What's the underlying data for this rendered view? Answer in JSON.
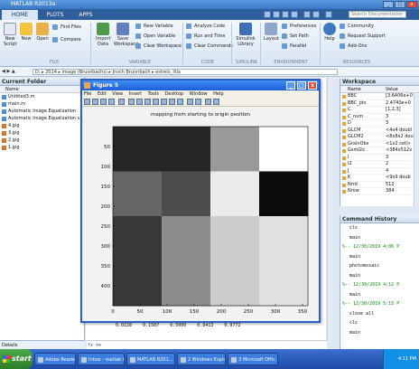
{
  "window": {
    "title": "MATLAB R2013a"
  },
  "ribbon_tabs": [
    "HOME",
    "PLOTS",
    "APPS"
  ],
  "search": {
    "placeholder": "Search Documentation"
  },
  "ribbon": {
    "file": [
      "New Script",
      "New",
      "Open",
      "Find Files",
      "Compare"
    ],
    "variable": [
      "Import Data",
      "Save Workspace",
      "New Variable",
      "Open Variable",
      "Clear Workspace"
    ],
    "code": [
      "Analyze Code",
      "Run and Time",
      "Clear Commands"
    ],
    "simulink": [
      "Simulink Library"
    ],
    "environment": [
      "Layout",
      "Preferences",
      "Set Path",
      "Parallel"
    ],
    "resources": [
      "Help",
      "Community",
      "Request Support",
      "Add-Ons"
    ],
    "sections": [
      "FILE",
      "VARIABLE",
      "CODE",
      "SIMULINK",
      "ENVIRONMENT",
      "RESOURCES"
    ]
  },
  "address": {
    "path": "D: ▸ 2014 ▸ image (Brusnbachs) ▸ Jnsch Brunnbach ▸ estrels_lilla"
  },
  "current_folder": {
    "title": "Current Folder",
    "column": "Name",
    "files": [
      "Untitled3.m",
      "main.m",
      "Automatic Image Equalization",
      "Automatic Image Equalization v",
      "4.jpg",
      "3.jpg",
      "2.jpg",
      "1.jpg"
    ],
    "details": "Details"
  },
  "figure": {
    "title": "Figure 5",
    "menu": [
      "File",
      "Edit",
      "View",
      "Insert",
      "Tools",
      "Desktop",
      "Window",
      "Help"
    ],
    "plot_title": "mapping from starting to origin position"
  },
  "chart_data": {
    "type": "heatmap",
    "title": "mapping from starting to origin position",
    "x_ticks": [
      0,
      50,
      100,
      150,
      200,
      250,
      300,
      350
    ],
    "y_ticks": [
      50,
      100,
      150,
      200,
      250,
      300,
      350,
      400
    ],
    "xlim": [
      0,
      360
    ],
    "ylim": [
      0,
      450
    ],
    "y_reversed": true,
    "grid_rows": 3,
    "grid_cols": 4,
    "cell_gray": [
      [
        0.15,
        0.15,
        0.6,
        1.0
      ],
      [
        0.4,
        0.3,
        0.92,
        0.05
      ],
      [
        0.22,
        0.55,
        0.8,
        0.88
      ]
    ],
    "last_row_gray": [
      0.22,
      0.55,
      0.8,
      0.88
    ]
  },
  "command_window": {
    "values": "0.0228    0.1587    0.5000    0.8413    0.9772",
    "prompt": ">>",
    "fx": "fx"
  },
  "workspace": {
    "title": "Workspace",
    "columns": [
      "Name",
      "Value"
    ],
    "rows": [
      [
        "BBC",
        "[3.6406e+0"
      ],
      [
        "BBC_pts",
        "2.4740e+0"
      ],
      [
        "C",
        "[1,2,3]"
      ],
      [
        "C_num",
        "3"
      ],
      [
        "D",
        "3"
      ],
      [
        "GLCM",
        "<4x4 doubl"
      ],
      [
        "GLCM2",
        "<8x8x2 dou"
      ],
      [
        "GrainObs",
        "<1x2 cell>"
      ],
      [
        "GsmGlc",
        "<384x512x"
      ],
      [
        "I",
        "3"
      ],
      [
        "I2",
        "2"
      ],
      [
        "J",
        "4"
      ],
      [
        "K",
        "<9x9 doub"
      ],
      [
        "Nrrd",
        "512"
      ],
      [
        "Nrow",
        "384"
      ]
    ]
  },
  "history": {
    "title": "Command History",
    "lines": [
      {
        "t": "clc",
        "s": false
      },
      {
        "t": "main",
        "s": false
      },
      {
        "t": "%-- 12/30/2019 4:06 P",
        "s": true
      },
      {
        "t": "main",
        "s": false
      },
      {
        "t": "photomosaic",
        "s": false
      },
      {
        "t": "main",
        "s": false
      },
      {
        "t": "%-- 12/30/2019 4:12 P",
        "s": true
      },
      {
        "t": "main",
        "s": false
      },
      {
        "t": "%-- 12/30/2019 5:15 P",
        "s": true
      },
      {
        "t": "close all",
        "s": false
      },
      {
        "t": "clc",
        "s": false
      },
      {
        "t": "main",
        "s": false
      }
    ]
  },
  "taskbar": {
    "start": "start",
    "tasks": [
      "Adobe Reader",
      "Inbox - matlab talk",
      "MATLAB R201...",
      "2 Windows Explo...",
      "3 Microsoft Offic..."
    ],
    "clock": "4:11 PM"
  },
  "colors": {
    "accent": "#2a5fc8",
    "taskbar": "#245edb",
    "start": "#3c9a38"
  }
}
